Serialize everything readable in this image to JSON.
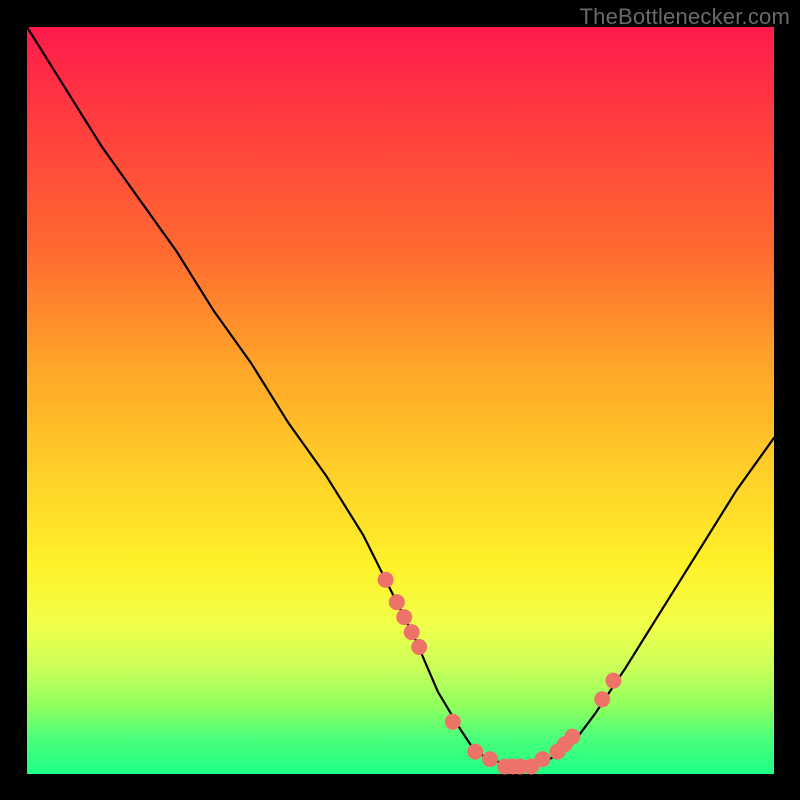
{
  "watermark": "TheBottlenecker.com",
  "colors": {
    "background": "#000000",
    "gradient_top": "#ff1a4d",
    "gradient_bottom": "#1eff86",
    "curve_stroke": "#000000",
    "marker_fill": "#ed7267"
  },
  "chart_data": {
    "type": "line",
    "title": "",
    "xlabel": "",
    "ylabel": "",
    "xlim": [
      0,
      100
    ],
    "ylim": [
      0,
      100
    ],
    "grid": false,
    "legend": false,
    "series": [
      {
        "name": "bottleneck-curve",
        "x": [
          0,
          5,
          10,
          15,
          20,
          25,
          30,
          35,
          40,
          45,
          50,
          52,
          55,
          58,
          60,
          62,
          65,
          68,
          70,
          73,
          76,
          80,
          85,
          90,
          95,
          100
        ],
        "values": [
          100,
          92,
          84,
          77,
          70,
          62,
          55,
          47,
          40,
          32,
          22,
          18,
          11,
          6,
          3,
          2,
          1,
          1,
          2,
          4,
          8,
          14,
          22,
          30,
          38,
          45
        ]
      }
    ],
    "markers": {
      "name": "sample-points",
      "x": [
        48,
        49.5,
        50.5,
        51.5,
        52.5,
        57,
        60,
        62,
        64,
        65,
        66,
        67.5,
        69,
        71,
        72,
        73,
        77,
        78.5
      ],
      "values": [
        26,
        23,
        21,
        19,
        17,
        7,
        3,
        2,
        1,
        1,
        1,
        1,
        2,
        3,
        4,
        5,
        10,
        12.5
      ]
    }
  }
}
